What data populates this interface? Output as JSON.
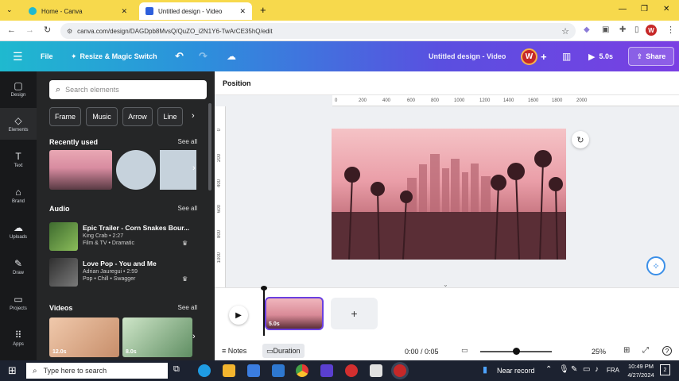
{
  "browser": {
    "tabs": [
      {
        "title": "Home - Canva",
        "active": false
      },
      {
        "title": "Untitled design - Video",
        "active": true
      }
    ],
    "new_tab": "+",
    "url": "canva.com/design/DAGDpb8MvsQ/QuZO_i2N1Y6-TwArCE35hQ/edit",
    "profile_initial": "W"
  },
  "header": {
    "file_label": "File",
    "resize_label": "Resize & Magic Switch",
    "doc_title": "Untitled design - Video",
    "avatar_initial": "W",
    "play_label": "5.0s",
    "share_label": "Share"
  },
  "rail": {
    "items": [
      {
        "label": "Design",
        "icon": "design-icon",
        "glyph": "▢"
      },
      {
        "label": "Elements",
        "icon": "elements-icon",
        "glyph": "◇"
      },
      {
        "label": "Text",
        "icon": "text-icon",
        "glyph": "T"
      },
      {
        "label": "Brand",
        "icon": "brand-icon",
        "glyph": "⌂"
      },
      {
        "label": "Uploads",
        "icon": "uploads-icon",
        "glyph": "☁"
      },
      {
        "label": "Draw",
        "icon": "draw-icon",
        "glyph": "✎"
      },
      {
        "label": "Projects",
        "icon": "projects-icon",
        "glyph": "▭"
      },
      {
        "label": "Apps",
        "icon": "apps-icon",
        "glyph": "⠿"
      }
    ]
  },
  "panel": {
    "search_placeholder": "Search elements",
    "chips": [
      "Frame",
      "Music",
      "Arrow",
      "Line"
    ],
    "recently_used": {
      "title": "Recently used",
      "see_all": "See all"
    },
    "audio": {
      "title": "Audio",
      "see_all": "See all",
      "tracks": [
        {
          "title": "Epic Trailer - Corn Snakes Bour...",
          "artist": "King Crab • 2:27",
          "tags": "Film & TV • Dramatic"
        },
        {
          "title": "Love Pop - You and Me",
          "artist": "Adrian Jauregui • 2:59",
          "tags": "Pop • Chill • Swagger"
        }
      ]
    },
    "videos": {
      "title": "Videos",
      "see_all": "See all",
      "items": [
        {
          "duration": "12.0s"
        },
        {
          "duration": "8.0s"
        }
      ]
    }
  },
  "workspace": {
    "position_label": "Position",
    "ruler_h": [
      "0",
      "200",
      "400",
      "600",
      "800",
      "1000",
      "1200",
      "1400",
      "1600",
      "1800",
      "2000"
    ],
    "ruler_v": [
      "0",
      "200",
      "400",
      "600",
      "800",
      "1000"
    ]
  },
  "timeline": {
    "clip_duration": "5.0s",
    "add_label": "+",
    "notes_label": "Notes",
    "duration_label": "Duration",
    "time_readout": "0:00 / 0:05",
    "zoom": "25%",
    "zoom_level": 0.5
  },
  "taskbar": {
    "search_placeholder": "Type here to search",
    "weather": "Near record",
    "lang": "FRA",
    "time": "10:49 PM",
    "date": "4/27/2024"
  },
  "colors": {
    "tabstrip": "#f7d94c",
    "canva_teal": "#1fb9cf",
    "canva_purple": "#7a3fe3",
    "panel_bg": "#252627",
    "rail_bg": "#18191b",
    "avatar": "#c62828"
  }
}
